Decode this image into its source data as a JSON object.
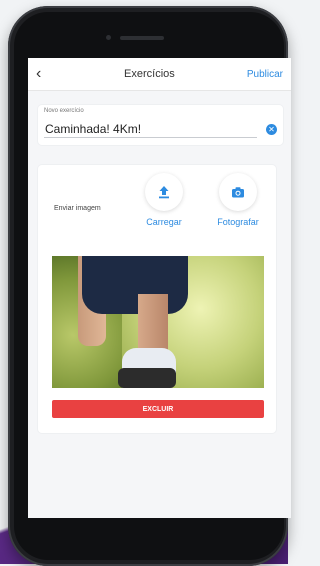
{
  "header": {
    "title": "Exercícios",
    "back_icon": "chevron-left-icon",
    "publish_label": "Publicar"
  },
  "form": {
    "exercise_label": "Novo exercício",
    "exercise_value": "Caminhada! 4Km!",
    "clear_icon": "close-icon"
  },
  "media": {
    "send_label": "Enviar imagem",
    "upload_label": "Carregar",
    "upload_icon": "upload-icon",
    "camera_label": "Fotografar",
    "camera_icon": "camera-icon",
    "delete_label": "EXCLUIR"
  },
  "colors": {
    "accent": "#2d8be0",
    "danger": "#e94141"
  }
}
